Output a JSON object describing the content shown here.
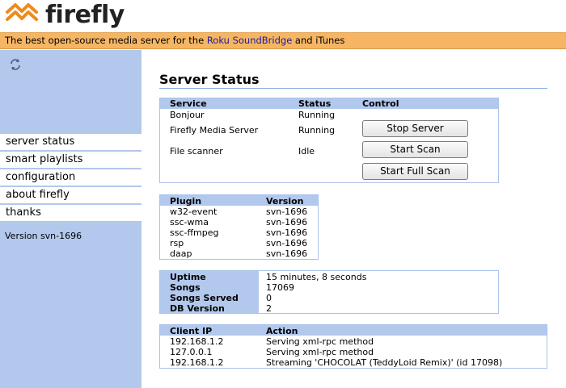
{
  "app": {
    "name": "firefly",
    "tagline_prefix": "The best open-source media server for the ",
    "tagline_link": "Roku SoundBridge",
    "tagline_suffix": " and iTunes"
  },
  "colors": {
    "sidebar": "#b2c8ec",
    "tagline": "#f5b563",
    "logo_orange": "#f08a1c"
  },
  "sidebar": {
    "refresh_icon": "refresh-icon",
    "items": [
      {
        "label": "server status"
      },
      {
        "label": "smart playlists"
      },
      {
        "label": "configuration"
      },
      {
        "label": "about firefly"
      },
      {
        "label": "thanks"
      }
    ],
    "version": "Version svn-1696"
  },
  "page": {
    "title": "Server Status"
  },
  "services": {
    "headers": [
      "Service",
      "Status",
      "Control"
    ],
    "rows": [
      {
        "service": "Bonjour",
        "status": "Running"
      },
      {
        "service": "Firefly Media Server",
        "status": "Running"
      },
      {
        "service": "File scanner",
        "status": "Idle"
      }
    ],
    "buttons": [
      "Stop Server",
      "Start Scan",
      "Start Full Scan"
    ]
  },
  "plugins": {
    "headers": [
      "Plugin",
      "Version"
    ],
    "rows": [
      {
        "plugin": "w32-event",
        "version": "svn-1696"
      },
      {
        "plugin": "ssc-wma",
        "version": "svn-1696"
      },
      {
        "plugin": "ssc-ffmpeg",
        "version": "svn-1696"
      },
      {
        "plugin": "rsp",
        "version": "svn-1696"
      },
      {
        "plugin": "daap",
        "version": "svn-1696"
      }
    ]
  },
  "stats": {
    "rows": [
      {
        "label": "Uptime",
        "value": "15 minutes, 8 seconds"
      },
      {
        "label": "Songs",
        "value": "17069"
      },
      {
        "label": "Songs Served",
        "value": "0"
      },
      {
        "label": "DB Version",
        "value": "2"
      }
    ]
  },
  "clients": {
    "headers": [
      "Client IP",
      "Action"
    ],
    "rows": [
      {
        "ip": "192.168.1.2",
        "action": "Serving xml-rpc method"
      },
      {
        "ip": "127.0.0.1",
        "action": "Serving xml-rpc method"
      },
      {
        "ip": "192.168.1.2",
        "action": "Streaming 'CHOCOLAT (TeddyLoid Remix)' (id 17098)"
      }
    ]
  }
}
